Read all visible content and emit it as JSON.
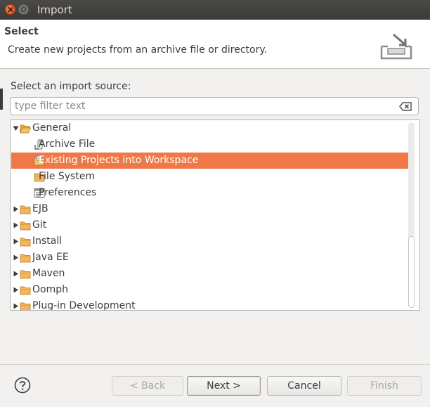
{
  "window": {
    "title": "Import"
  },
  "banner": {
    "title": "Select",
    "description": "Create new projects from an archive file or directory.",
    "icon": "import-wizard-icon"
  },
  "source": {
    "label": "Select an import source:",
    "filter_placeholder": "type filter text",
    "filter_value": ""
  },
  "tree": {
    "items": [
      {
        "label": "General",
        "level": 0,
        "expandable": true,
        "expanded": true,
        "icon": "folder-open-icon",
        "selected": false
      },
      {
        "label": "Archive File",
        "level": 1,
        "expandable": false,
        "expanded": false,
        "icon": "archive-file-icon",
        "selected": false
      },
      {
        "label": "Existing Projects into Workspace",
        "level": 1,
        "expandable": false,
        "expanded": false,
        "icon": "existing-projects-icon",
        "selected": true
      },
      {
        "label": "File System",
        "level": 1,
        "expandable": false,
        "expanded": false,
        "icon": "folder-icon",
        "selected": false
      },
      {
        "label": "Preferences",
        "level": 1,
        "expandable": false,
        "expanded": false,
        "icon": "preferences-icon",
        "selected": false
      },
      {
        "label": "EJB",
        "level": 0,
        "expandable": true,
        "expanded": false,
        "icon": "folder-icon",
        "selected": false
      },
      {
        "label": "Git",
        "level": 0,
        "expandable": true,
        "expanded": false,
        "icon": "folder-icon",
        "selected": false
      },
      {
        "label": "Install",
        "level": 0,
        "expandable": true,
        "expanded": false,
        "icon": "folder-icon",
        "selected": false
      },
      {
        "label": "Java EE",
        "level": 0,
        "expandable": true,
        "expanded": false,
        "icon": "folder-icon",
        "selected": false
      },
      {
        "label": "Maven",
        "level": 0,
        "expandable": true,
        "expanded": false,
        "icon": "folder-icon",
        "selected": false
      },
      {
        "label": "Oomph",
        "level": 0,
        "expandable": true,
        "expanded": false,
        "icon": "folder-icon",
        "selected": false
      },
      {
        "label": "Plug-in Development",
        "level": 0,
        "expandable": true,
        "expanded": false,
        "icon": "folder-icon",
        "selected": false
      }
    ]
  },
  "buttons": {
    "back": "< Back",
    "next": "Next >",
    "cancel": "Cancel",
    "finish": "Finish"
  },
  "colors": {
    "selection": "#f07746",
    "titlebar": "#3c3b37",
    "close_button": "#df4b16"
  }
}
